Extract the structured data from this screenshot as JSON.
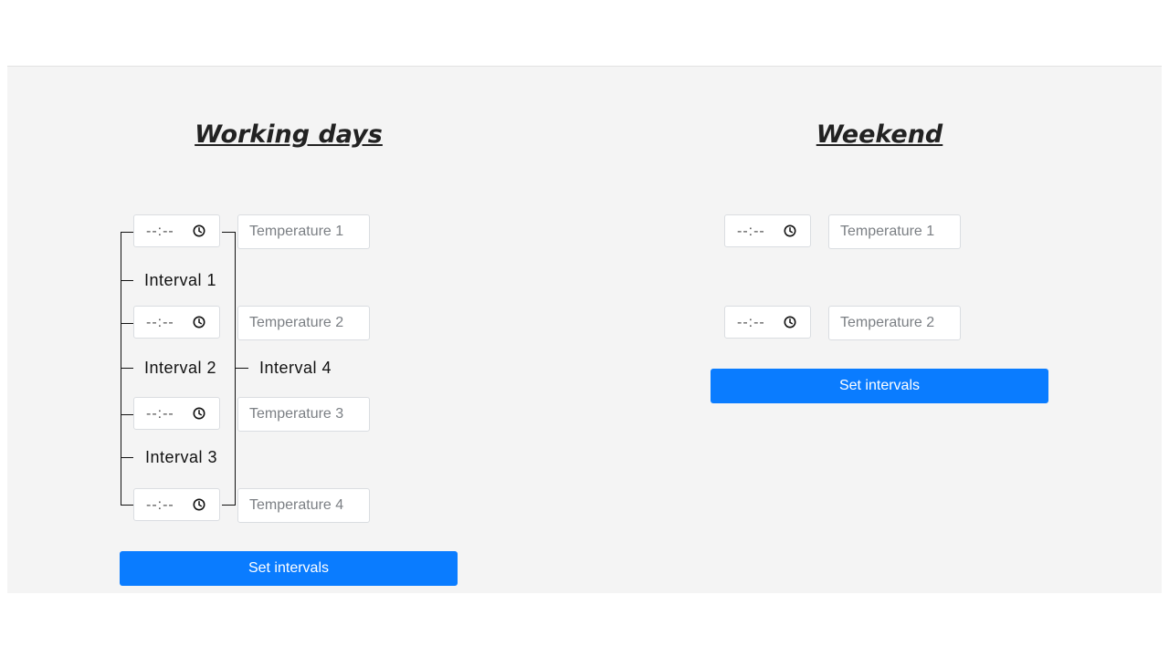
{
  "working_days": {
    "title": "Working days",
    "times": [
      "--:--",
      "--:--",
      "--:--",
      "--:--"
    ],
    "temperatures": [
      {
        "placeholder": "Temperature 1"
      },
      {
        "placeholder": "Temperature 2"
      },
      {
        "placeholder": "Temperature 3"
      },
      {
        "placeholder": "Temperature 4"
      }
    ],
    "interval_labels": [
      "Interval 1",
      "Interval 2",
      "Interval 3",
      "Interval 4"
    ],
    "button_label": "Set intervals"
  },
  "weekend": {
    "title": "Weekend",
    "times": [
      "--:--",
      "--:--"
    ],
    "temperatures": [
      {
        "placeholder": "Temperature 1"
      },
      {
        "placeholder": "Temperature 2"
      }
    ],
    "button_label": "Set intervals"
  },
  "icons": {
    "time_input": "clock-icon"
  },
  "colors": {
    "button": "#0a7cff",
    "panel": "#f4f4f4"
  }
}
